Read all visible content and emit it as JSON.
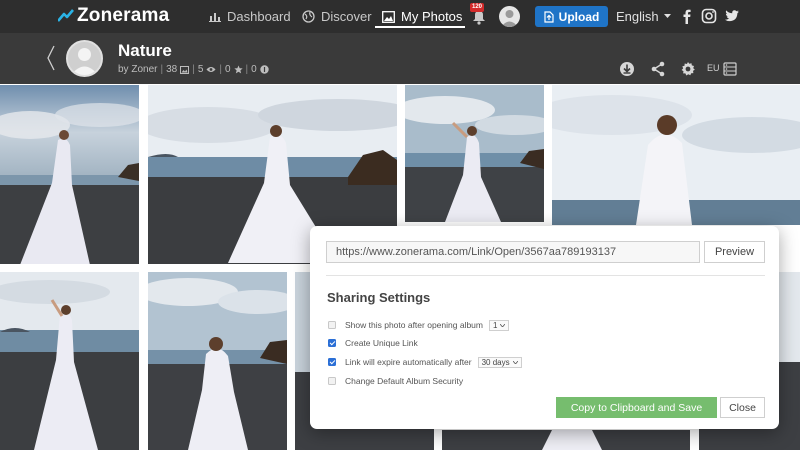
{
  "brand": {
    "name": "Zonerama",
    "accent": "#1f9bd1"
  },
  "nav": {
    "items": [
      {
        "label": "Dashboard",
        "icon": "bar-chart-icon"
      },
      {
        "label": "Discover",
        "icon": "globe-icon"
      },
      {
        "label": "My Photos",
        "icon": "photo-icon",
        "active": true
      }
    ],
    "notifications_count": "120",
    "upload_label": "Upload",
    "language": "English",
    "social": [
      "facebook-icon",
      "instagram-icon",
      "twitter-icon"
    ]
  },
  "album": {
    "title": "Nature",
    "owner": "by Zoner",
    "photo_count": "38",
    "view_count": "5",
    "star_count": "0",
    "donation_count": "0",
    "region": "EU"
  },
  "photos": [
    {
      "scene": "woman in white dress on beach, cloudy sky"
    },
    {
      "scene": "woman in white dress on beach, rocks right"
    },
    {
      "scene": "woman raising arm on beach"
    },
    {
      "scene": "close-up woman in white dress, sea behind"
    },
    {
      "scene": "woman raising arm on beach"
    },
    {
      "scene": "woman in white dress close-up, cloudy"
    },
    {
      "scene": "beach photo partially covered"
    }
  ],
  "share_dialog": {
    "link_value": "https://www.zonerama.com/Link/Open/3567aa789193137",
    "preview_label": "Preview",
    "title": "Sharing Settings",
    "options": [
      {
        "label": "Show this photo after opening album",
        "checked": false,
        "select": "1"
      },
      {
        "label": "Create Unique Link",
        "checked": true
      },
      {
        "label": "Link will expire automatically after",
        "checked": true,
        "select": "30 days"
      },
      {
        "label": "Change Default Album Security",
        "checked": false
      }
    ],
    "copy_label": "Copy to Clipboard and Save",
    "close_label": "Close"
  },
  "colors": {
    "topbar": "#2e2e2e",
    "album_bar": "#3a3a3a",
    "upload": "#1f74c7",
    "copy_button": "#76bd6e",
    "checkbox": "#2b6fd6"
  }
}
